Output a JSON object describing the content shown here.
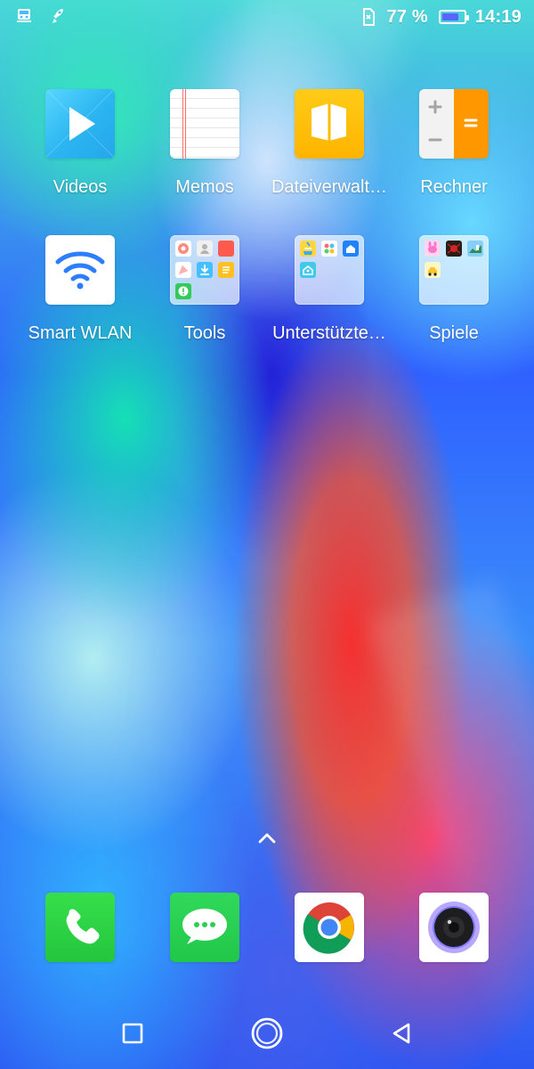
{
  "status_bar": {
    "left_icons": [
      "train-icon",
      "rocket-icon"
    ],
    "right_icons": [
      "sim-card-icon",
      "battery-icon"
    ],
    "battery_percent_text": "77 %",
    "battery_level": 0.77,
    "time": "14:19"
  },
  "home_apps": [
    {
      "label": "Videos",
      "icon": "video-play-icon"
    },
    {
      "label": "Memos",
      "icon": "memo-notes-icon"
    },
    {
      "label": "Dateiverwalt…",
      "icon": "file-manager-icon"
    },
    {
      "label": "Rechner",
      "icon": "calculator-icon"
    },
    {
      "label": "Smart WLAN",
      "icon": "wifi-icon"
    },
    {
      "label": "Tools",
      "icon": "tools-folder-icon"
    },
    {
      "label": "Unterstützte…",
      "icon": "supported-folder-icon"
    },
    {
      "label": "Spiele",
      "icon": "games-folder-icon"
    }
  ],
  "drawer_handle": {
    "icon": "chevron-up-icon"
  },
  "dock": [
    {
      "icon": "phone-icon"
    },
    {
      "icon": "messages-icon"
    },
    {
      "icon": "chrome-icon"
    },
    {
      "icon": "camera-icon"
    }
  ],
  "navigation_bar": [
    {
      "icon": "recent-apps-icon"
    },
    {
      "icon": "home-icon"
    },
    {
      "icon": "back-icon"
    }
  ],
  "colors": {
    "battery_fill": "#5a64ff",
    "status_text": "#ffffff"
  }
}
